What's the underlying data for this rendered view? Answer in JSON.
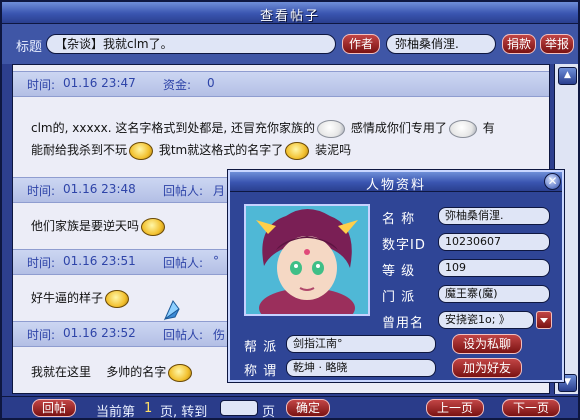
{
  "window": {
    "title": "查看帖子",
    "close": "✕"
  },
  "subject": {
    "label": "标题",
    "value": "【杂谈】我就clm了。",
    "author_btn": "作者",
    "author_name": "弥柚桑俏浬.",
    "donate_btn": "捐款",
    "report_btn": "举报"
  },
  "posts": [
    {
      "time_label": "时间:",
      "time": "01.16 23:47",
      "extra_label": "资金:",
      "extra": "0",
      "lines": [
        "clm的, xxxxx. 这名字格式到处都是, 还冒充你家族的",
        "感情成你们专用了",
        "有",
        "能耐给我杀到不玩",
        "我tm就这格式的名字了",
        "装泥吗"
      ]
    },
    {
      "time_label": "时间:",
      "time": "01.16 23:48",
      "extra_label": "回帖人:",
      "extra": "月",
      "lines": [
        "他们家族是要逆天吗"
      ]
    },
    {
      "time_label": "时间:",
      "time": "01.16 23:51",
      "extra_label": "回帖人:",
      "extra": "°",
      "lines": [
        "好牛逼的样子"
      ]
    },
    {
      "time_label": "时间:",
      "time": "01.16 23:52",
      "extra_label": "回帖人:",
      "extra": "伤",
      "lines": [
        "我就在这里",
        "多帅的名字"
      ]
    }
  ],
  "bottom": {
    "reply_btn": "回帖",
    "page_prefix": "当前第",
    "page_num": "1",
    "page_mid": "页, 转到",
    "goto_value": "",
    "page_suffix": "页",
    "confirm_btn": "确定",
    "prev_btn": "上一页",
    "next_btn": "下一页"
  },
  "profile": {
    "title": "人物资料",
    "close": "✕",
    "fields": [
      {
        "label": "名  称",
        "value": "弥柚桑俏浬."
      },
      {
        "label": "数字ID",
        "value": "10230607"
      },
      {
        "label": "等  级",
        "value": "109"
      },
      {
        "label": "门  派",
        "value": "魔王寨(魔)"
      },
      {
        "label": "曾用名",
        "value": "安挠瓷1o; 》"
      }
    ],
    "gang_label": "帮  派",
    "gang_value": "剑指江南°",
    "title_label": "称  谓",
    "title_value": "乾坤 · 略晓",
    "pm_btn": "设为私聊",
    "friend_btn": "加为好友"
  }
}
